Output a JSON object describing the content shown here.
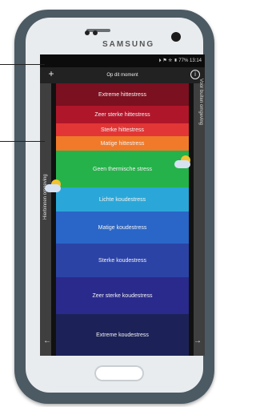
{
  "device": {
    "brand": "SAMSUNG"
  },
  "status_bar": {
    "text": "⏵ ⚑ ☆ ▮ 77% 13:14"
  },
  "app": {
    "title": "Op dit moment",
    "plus_label": "+",
    "info_label": "i",
    "left_side_label": "Hierbinnen omgeving",
    "right_side_label": "Voor buiten omgeving",
    "left_arrow": "←",
    "right_arrow": "→"
  },
  "bands": [
    {
      "label": "Extreme hittestress",
      "color": "#7b1020"
    },
    {
      "label": "Zeer sterke hittestress",
      "color": "#b0162a"
    },
    {
      "label": "Sterke hittestress",
      "color": "#e23636"
    },
    {
      "label": "Matige hittestress",
      "color": "#f07a2a"
    },
    {
      "label": "Geen thermische stress",
      "color": "#25b24a"
    },
    {
      "label": "Lichte koudestress",
      "color": "#2aa7d8"
    },
    {
      "label": "Matige koudestress",
      "color": "#2a66c8"
    },
    {
      "label": "Sterke koudestress",
      "color": "#2c43a6"
    },
    {
      "label": "Zeer sterke koudestress",
      "color": "#2a2a8c"
    },
    {
      "label": "Extreme koudestress",
      "color": "#1c2258"
    }
  ]
}
